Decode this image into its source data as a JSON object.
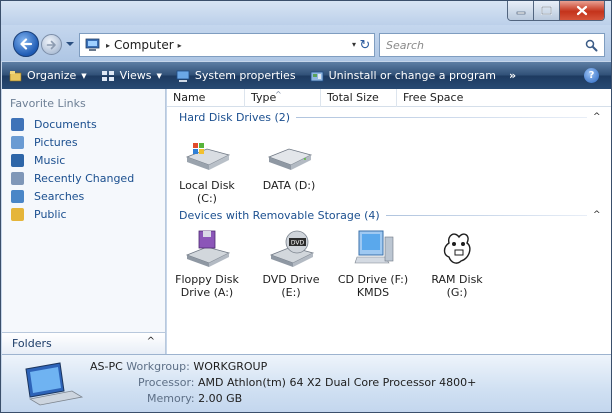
{
  "window": {
    "caption": {
      "minimize": "minimize",
      "maximize": "maximize",
      "close": "close"
    }
  },
  "address_bar": {
    "separator": "▸",
    "location": "Computer",
    "trail_arrow": "▸",
    "dropdown": "▾",
    "refresh": "↻"
  },
  "search": {
    "placeholder": "Search"
  },
  "command_bar": {
    "organize": "Organize",
    "views": "Views",
    "system_properties": "System properties",
    "uninstall": "Uninstall or change a program",
    "more": "»",
    "help": "?"
  },
  "nav_pane": {
    "heading": "Favorite Links",
    "items": [
      {
        "label": "Documents",
        "icon": "documents-icon",
        "color": "#3f73b8"
      },
      {
        "label": "Pictures",
        "icon": "pictures-icon",
        "color": "#6a9bd3"
      },
      {
        "label": "Music",
        "icon": "music-icon",
        "color": "#2e66a8"
      },
      {
        "label": "Recently Changed",
        "icon": "recent-icon",
        "color": "#7f97b8"
      },
      {
        "label": "Searches",
        "icon": "searches-icon",
        "color": "#4a86c7"
      },
      {
        "label": "Public",
        "icon": "public-icon",
        "color": "#e5b53a"
      }
    ],
    "folders_label": "Folders",
    "folders_chevron": "^"
  },
  "columns": {
    "name": "Name",
    "type": "Type",
    "total_size": "Total Size",
    "free_space": "Free Space",
    "sort_indicator": "^"
  },
  "groups": {
    "hard_disks": {
      "title": "Hard Disk Drives (2)",
      "chevron": "^"
    },
    "removable": {
      "title": "Devices with Removable Storage (4)",
      "chevron": "^"
    }
  },
  "drives": {
    "local_c": {
      "line1": "Local Disk",
      "line2": "(C:)"
    },
    "data_d": {
      "line1": "DATA (D:)"
    },
    "floppy_a": {
      "line1": "Floppy Disk",
      "line2": "Drive (A:)"
    },
    "dvd_e": {
      "line1": "DVD Drive",
      "line2": "(E:)",
      "badge": "DVD"
    },
    "cd_f": {
      "line1": "CD Drive (F:)",
      "line2": "KMDS"
    },
    "ram_g": {
      "line1": "RAM Disk",
      "line2": "(G:)"
    }
  },
  "details": {
    "pc_name": "AS-PC",
    "workgroup_label": "Workgroup:",
    "workgroup": "WORKGROUP",
    "processor_label": "Processor:",
    "processor": "AMD Athlon(tm) 64 X2 Dual Core Processor 4800+",
    "memory_label": "Memory:",
    "memory": "2.00 GB"
  },
  "colors": {
    "command_bar": "#284a73",
    "link_text": "#1b4f8f",
    "close_button": "#c4331b"
  }
}
